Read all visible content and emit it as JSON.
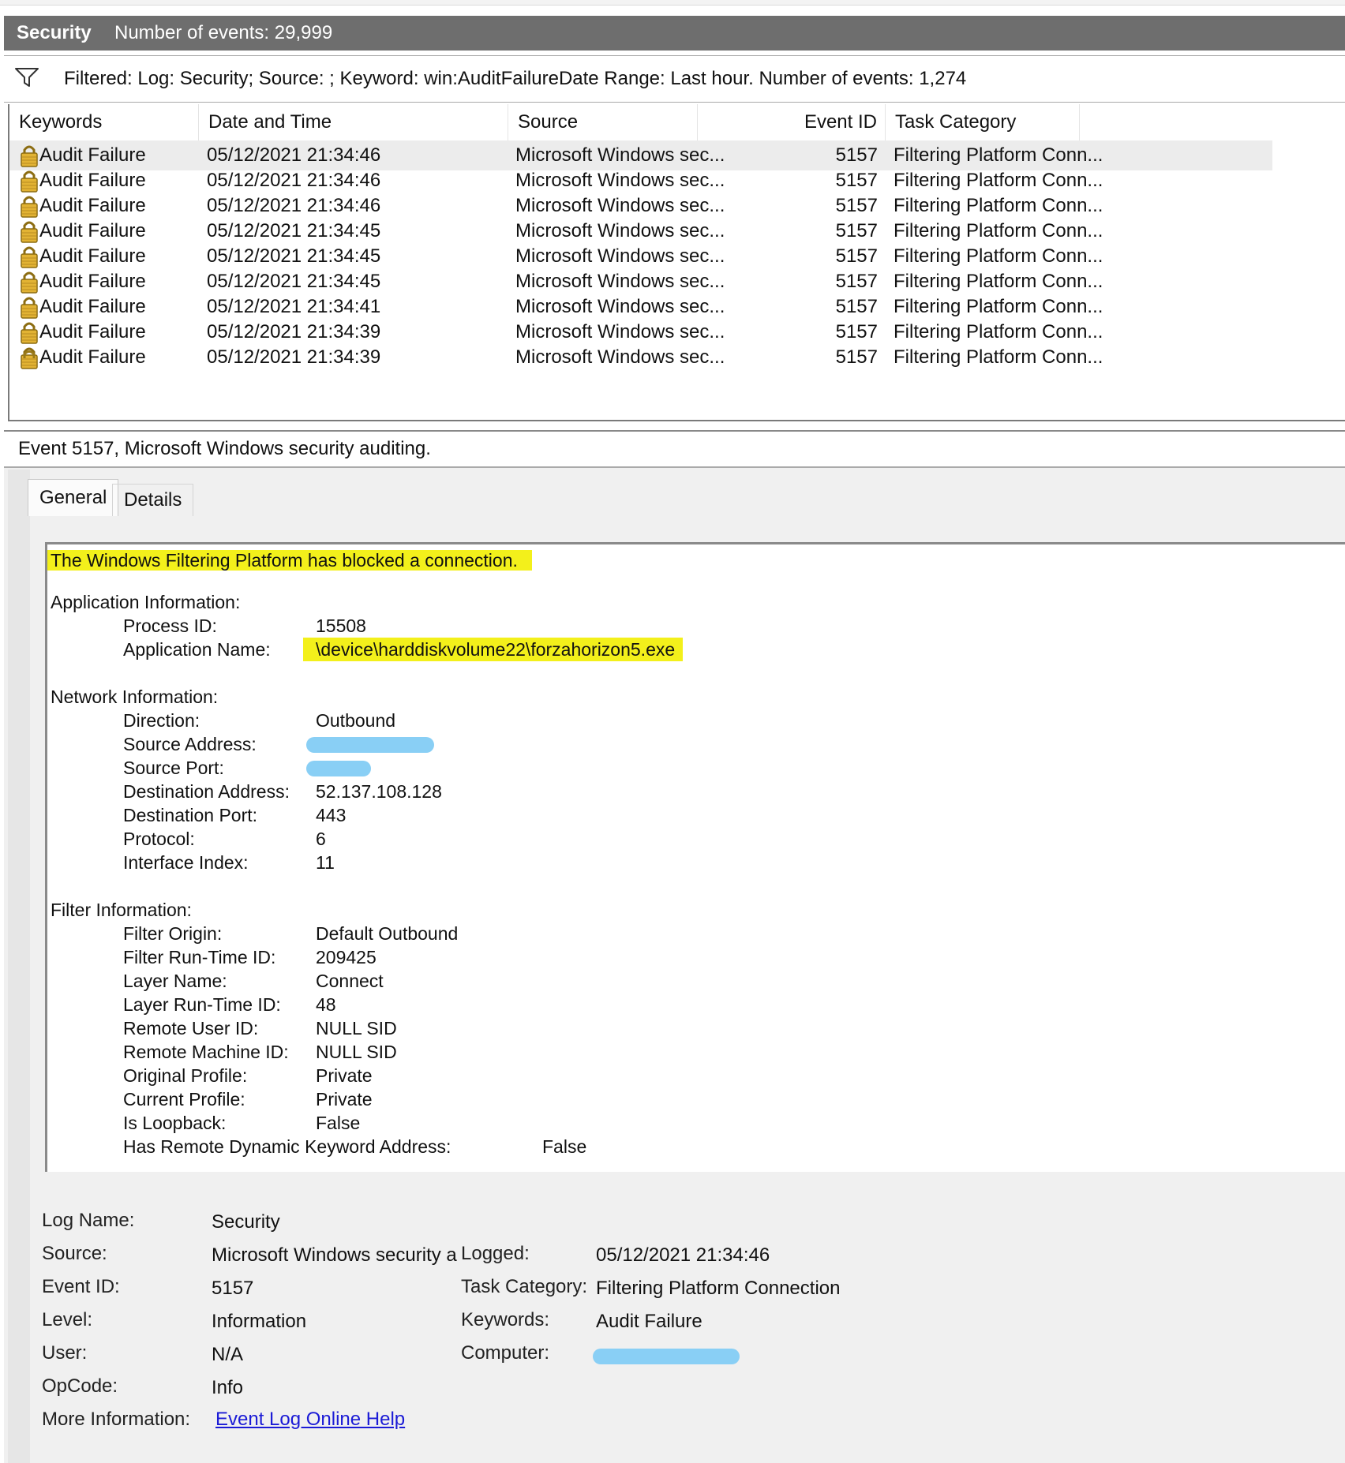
{
  "header": {
    "log_name": "Security",
    "count_text": "Number of events: 29,999"
  },
  "filter": {
    "text": "Filtered: Log: Security; Source: ; Keyword: win:AuditFailureDate Range: Last hour. Number of events: 1,274"
  },
  "columns": [
    "Keywords",
    "Date and Time",
    "Source",
    "Event ID",
    "Task Category"
  ],
  "rows": [
    [
      "Audit Failure",
      "05/12/2021 21:34:46",
      "Microsoft Windows sec...",
      "5157",
      "Filtering Platform Conn..."
    ],
    [
      "Audit Failure",
      "05/12/2021 21:34:46",
      "Microsoft Windows sec...",
      "5157",
      "Filtering Platform Conn..."
    ],
    [
      "Audit Failure",
      "05/12/2021 21:34:46",
      "Microsoft Windows sec...",
      "5157",
      "Filtering Platform Conn..."
    ],
    [
      "Audit Failure",
      "05/12/2021 21:34:45",
      "Microsoft Windows sec...",
      "5157",
      "Filtering Platform Conn..."
    ],
    [
      "Audit Failure",
      "05/12/2021 21:34:45",
      "Microsoft Windows sec...",
      "5157",
      "Filtering Platform Conn..."
    ],
    [
      "Audit Failure",
      "05/12/2021 21:34:45",
      "Microsoft Windows sec...",
      "5157",
      "Filtering Platform Conn..."
    ],
    [
      "Audit Failure",
      "05/12/2021 21:34:41",
      "Microsoft Windows sec...",
      "5157",
      "Filtering Platform Conn..."
    ],
    [
      "Audit Failure",
      "05/12/2021 21:34:39",
      "Microsoft Windows sec...",
      "5157",
      "Filtering Platform Conn..."
    ],
    [
      "Audit Failure",
      "05/12/2021 21:34:39",
      "Microsoft Windows sec...",
      "5157",
      "Filtering Platform Conn..."
    ]
  ],
  "icons": {
    "row": "lock-icon",
    "filter": "funnel-icon"
  },
  "preview": {
    "title": "Event 5157, Microsoft Windows security auditing.",
    "tabs": [
      "General",
      "Details"
    ],
    "headline": "The Windows Filtering Platform has blocked a connection.",
    "sections": {
      "app": {
        "heading": "Application Information:",
        "fields": [
          [
            "Process ID:",
            "15508"
          ],
          [
            "Application Name:",
            "\\device\\harddiskvolume22\\forzahorizon5.exe"
          ]
        ]
      },
      "net": {
        "heading": "Network Information:",
        "fields": [
          [
            "Direction:",
            "Outbound"
          ],
          [
            "Source Address:",
            ""
          ],
          [
            "Source Port:",
            ""
          ],
          [
            "Destination Address:",
            "52.137.108.128"
          ],
          [
            "Destination Port:",
            "443"
          ],
          [
            "Protocol:",
            "6"
          ],
          [
            "Interface Index:",
            "11"
          ]
        ]
      },
      "filter": {
        "heading": "Filter Information:",
        "fields": [
          [
            "Filter Origin:",
            "Default Outbound"
          ],
          [
            "Filter Run-Time ID:",
            "209425"
          ],
          [
            "Layer Name:",
            "Connect"
          ],
          [
            "Layer Run-Time ID:",
            "48"
          ],
          [
            "Remote User ID:",
            "NULL SID"
          ],
          [
            "Remote Machine ID:",
            "NULL SID"
          ],
          [
            "Original Profile:",
            "Private"
          ],
          [
            "Current Profile:",
            "Private"
          ],
          [
            "Is Loopback:",
            "False"
          ]
        ]
      },
      "last": [
        "Has Remote Dynamic Keyword Address:",
        "False"
      ]
    },
    "meta_left": [
      [
        "Log Name:",
        "Security"
      ],
      [
        "Source:",
        "Microsoft Windows security a"
      ],
      [
        "Event ID:",
        "5157"
      ],
      [
        "Level:",
        "Information"
      ],
      [
        "User:",
        "N/A"
      ],
      [
        "OpCode:",
        "Info"
      ],
      [
        "More Information:",
        "Event Log Online Help"
      ]
    ],
    "meta_right": [
      [
        "Logged:",
        "05/12/2021 21:34:46"
      ],
      [
        "Task Category:",
        "Filtering Platform Connection"
      ],
      [
        "Keywords:",
        "Audit Failure"
      ],
      [
        "Computer:",
        ""
      ]
    ]
  },
  "colors": {
    "header_bg": "#6e6e6e",
    "highlight": "#f3f01b",
    "redaction": "#89cff5",
    "link": "#1b1bd6",
    "selected_row": "#ececec"
  }
}
